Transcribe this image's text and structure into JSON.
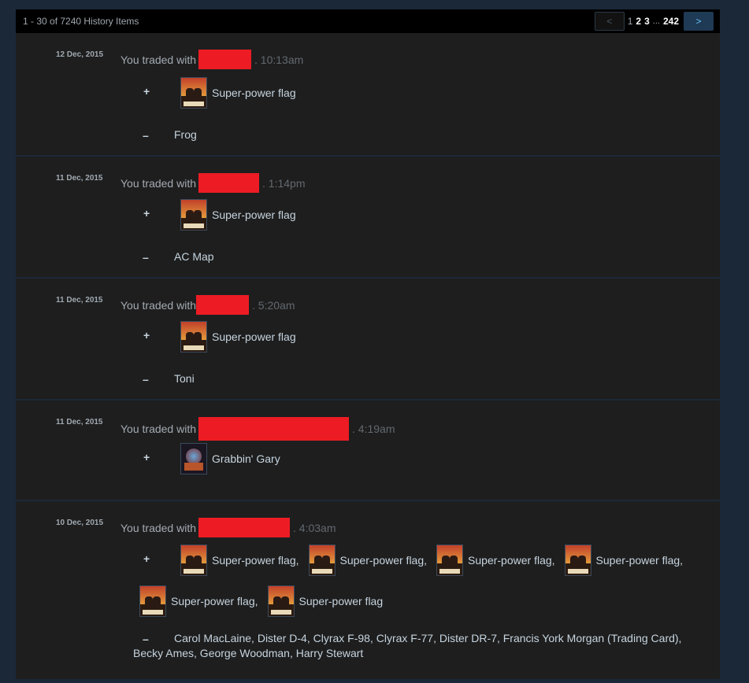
{
  "topbar": {
    "count_label": "1 - 30 of 7240 History Items",
    "prev_label": "<",
    "next_label": ">",
    "pages": [
      "1",
      "2",
      "3"
    ],
    "dots": "...",
    "last_page": "242"
  },
  "plus": "+",
  "minus": "–",
  "trades": [
    {
      "date": "12 Dec, 2015",
      "headline": "You traded with",
      "time": ". 10:13am",
      "received": [
        "Super-power flag"
      ],
      "given": "Frog"
    },
    {
      "date": "11 Dec, 2015",
      "headline": "You traded with",
      "time": ". 1:14pm",
      "received": [
        "Super-power flag"
      ],
      "given": "AC Map"
    },
    {
      "date": "11 Dec, 2015",
      "headline": "You traded with",
      "time": ". 5:20am",
      "received": [
        "Super-power flag"
      ],
      "given": "Toni"
    },
    {
      "date": "11 Dec, 2015",
      "headline": "You traded with",
      "time": ". 4:19am",
      "received": [
        "Grabbin' Gary"
      ],
      "given": ""
    },
    {
      "date": "10 Dec, 2015",
      "headline": "You traded with",
      "time": ". 4:03am",
      "received": [
        "Super-power flag,",
        "Super-power flag,",
        "Super-power flag,",
        "Super-power flag,",
        "Super-power flag,",
        "Super-power flag"
      ],
      "given_line1": "Carol MacLaine, Dister D-4, Clyrax F-98, Clyrax F-77, Dister DR-7, Francis York Morgan (Trading Card),",
      "given_line2": "Becky Ames, George Woodman, Harry Stewart"
    }
  ]
}
